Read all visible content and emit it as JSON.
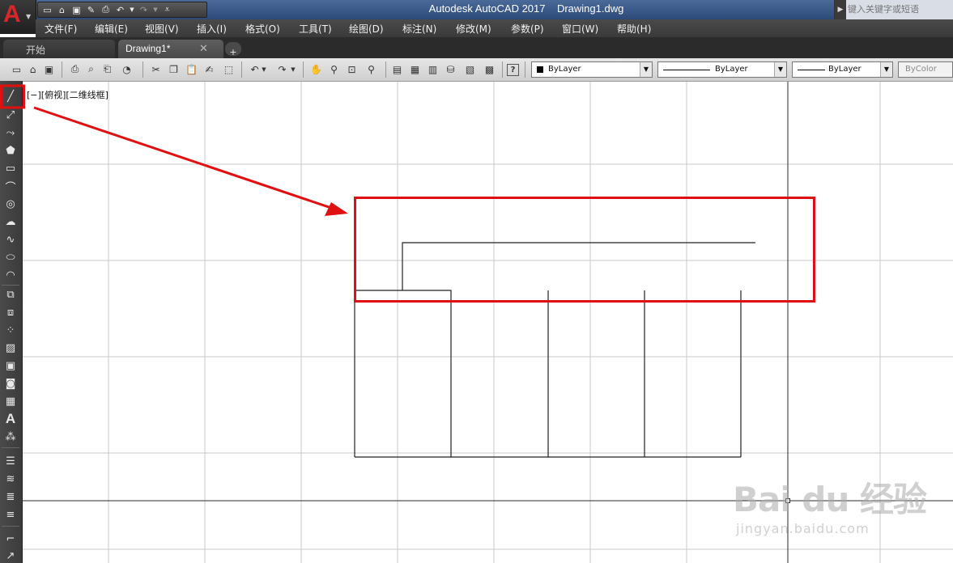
{
  "app": {
    "logo_letter": "A",
    "window_title": "Autodesk AutoCAD 2017    Drawing1.dwg"
  },
  "search": {
    "placeholder": "键入关键字或短语"
  },
  "menu": [
    "文件(F)",
    "编辑(E)",
    "视图(V)",
    "插入(I)",
    "格式(O)",
    "工具(T)",
    "绘图(D)",
    "标注(N)",
    "修改(M)",
    "参数(P)",
    "窗口(W)",
    "帮助(H)"
  ],
  "tabs": {
    "start": "开始",
    "drawing": "Drawing1*",
    "close_glyph": "✕",
    "new_glyph": "+"
  },
  "properties": {
    "color": "ByLayer",
    "linetype": "ByLayer",
    "lineweight": "ByLayer",
    "plotstyle": "ByColor"
  },
  "viewport": {
    "label": "[−][俯视][二维线框]"
  },
  "icons": {
    "toolbar": [
      "new-icon",
      "open-icon",
      "save-icon",
      "print-icon",
      "print-preview-icon",
      "publish-icon",
      "3d-print-icon",
      "cut-icon",
      "copy-icon",
      "paste-icon",
      "match-properties-icon",
      "block-editor-icon",
      "undo-icon",
      "redo-icon",
      "pan-icon",
      "zoom-realtime-icon",
      "zoom-window-icon",
      "zoom-previous-icon",
      "properties-icon",
      "design-center-icon",
      "tool-palettes-icon",
      "sheet-set-icon",
      "markup-icon",
      "quickcalc-icon",
      "help-icon"
    ],
    "palette": [
      "line-icon",
      "construction-line-icon",
      "polyline-icon",
      "polygon-icon",
      "rectangle-icon",
      "arc-icon",
      "circle-icon",
      "revision-cloud-icon",
      "spline-icon",
      "ellipse-icon",
      "ellipse-arc-icon",
      "insert-block-icon",
      "make-block-icon",
      "point-icon",
      "hatch-icon",
      "gradient-icon",
      "region-icon",
      "table-icon",
      "multiline-text-icon",
      "add-selected-icon",
      "layer-icon",
      "layer-match-icon",
      "layer-previous-icon",
      "layer-isolate-icon",
      "trim-icon",
      "extend-icon"
    ]
  },
  "colors": {
    "highlight_red": "#e01010",
    "title_bar": "#2c4a78",
    "dark_ui": "#3b3b3b"
  },
  "watermark": {
    "brand": "Bai du 经验",
    "url": "jingyan.baidu.com"
  }
}
